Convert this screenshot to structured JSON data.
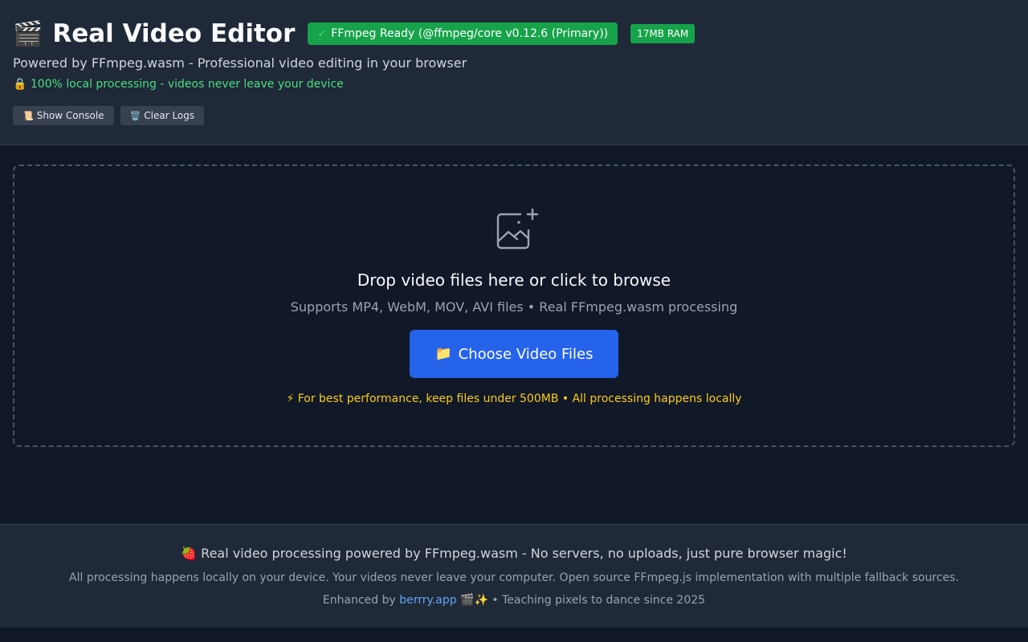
{
  "header": {
    "icon": "clapper-board-icon",
    "title": "Real Video Editor",
    "status_badge": "FFmpeg Ready (@ffmpeg/core v0.12.6 (Primary))",
    "status_check": "✓",
    "ram_badge": "17MB RAM",
    "subtitle": "Powered by FFmpeg.wasm - Professional video editing in your browser",
    "local_note_icon": "🔒",
    "local_note": "100% local processing - videos never leave your device",
    "buttons": {
      "show_console_icon": "📜",
      "show_console": "Show Console",
      "clear_logs_icon": "🗑️",
      "clear_logs": "Clear Logs"
    }
  },
  "dropzone": {
    "icon": "image-add-icon",
    "title": "Drop video files here or click to browse",
    "subtitle": "Supports MP4, WebM, MOV, AVI files • Real FFmpeg.wasm processing",
    "button_icon": "📁",
    "button_label": "Choose Video Files",
    "perf_note": "⚡ For best performance, keep files under 500MB • All processing happens locally"
  },
  "footer": {
    "main": "🍓 Real video processing powered by FFmpeg.wasm - No servers, no uploads, just pure browser magic!",
    "description": "All processing happens locally on your device. Your videos never leave your computer. Open source FFmpeg.js implementation with multiple fallback sources.",
    "credit_prefix": "Enhanced by ",
    "credit_link": "berrry.app",
    "credit_suffix": " 🎬✨ • Teaching pixels to dance since 2025"
  },
  "colors": {
    "background": "#111827",
    "panel": "#1f2937",
    "success": "#16a34a",
    "primary": "#2563eb",
    "accent_green": "#4ade80",
    "warning": "#facc15",
    "link": "#60a5fa"
  }
}
